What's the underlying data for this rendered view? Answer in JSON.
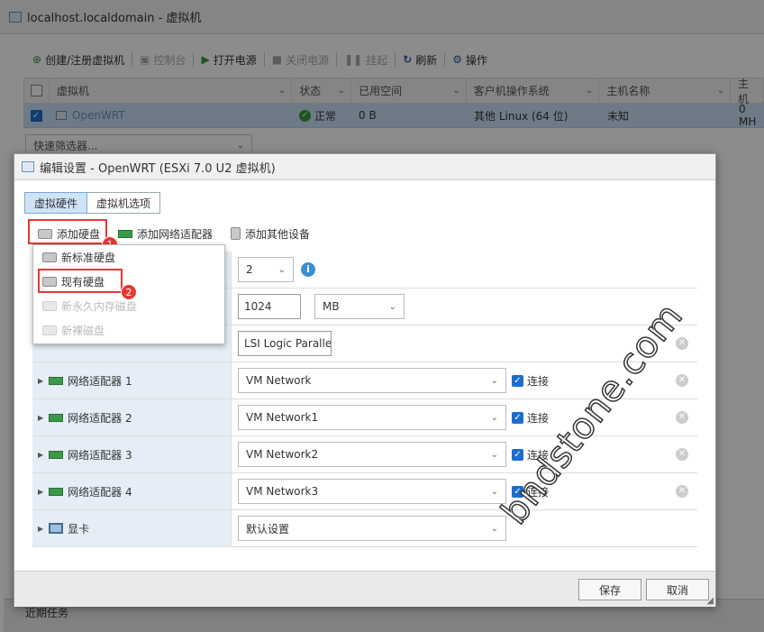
{
  "window_title": "localhost.localdomain - 虚拟机",
  "toolbar": {
    "create": "创建/注册虚拟机",
    "console": "控制台",
    "power_on": "打开电源",
    "power_off": "关闭电源",
    "suspend": "挂起",
    "refresh": "刷新",
    "actions": "操作"
  },
  "grid": {
    "columns": [
      "虚拟机",
      "状态",
      "已用空间",
      "客户机操作系统",
      "主机名称",
      "主机"
    ],
    "row": {
      "name": "OpenWRT",
      "status": "正常",
      "used": "0 B",
      "os": "其他 Linux (64 位)",
      "host": "未知",
      "host2": "0 MH"
    }
  },
  "quick_filter": "快速筛选器...",
  "bottom_panel": {
    "title": "近期任务"
  },
  "dialog": {
    "title": "编辑设置 - OpenWRT (ESXi 7.0 U2 虚拟机)",
    "tabs": [
      "虚拟硬件",
      "虚拟机选项"
    ],
    "add_hdd": "添加硬盘",
    "add_nic": "添加网络适配器",
    "add_other": "添加其他设备",
    "menu": [
      "新标准硬盘",
      "现有硬盘",
      "新永久内存磁盘",
      "新裸磁盘"
    ],
    "cpu_value": "2",
    "mem_value": "1024",
    "mem_unit": "MB",
    "scsi_value": "LSI Logic Parallel",
    "nic_labels": [
      "网络适配器 1",
      "网络适配器 2",
      "网络适配器 3",
      "网络适配器 4"
    ],
    "nic_values": [
      "VM Network",
      "VM Network1",
      "VM Network2",
      "VM Network3"
    ],
    "connect_label": "连接",
    "display_label": "显卡",
    "display_value": "默认设置",
    "save": "保存",
    "cancel": "取消"
  },
  "annotations": {
    "badge1": "1",
    "badge2": "2"
  },
  "watermark": "bndstone.com",
  "colors": {
    "accent": "#1c6dd0",
    "highlight": "#e53935",
    "row_selected": "#c8e0f6"
  }
}
